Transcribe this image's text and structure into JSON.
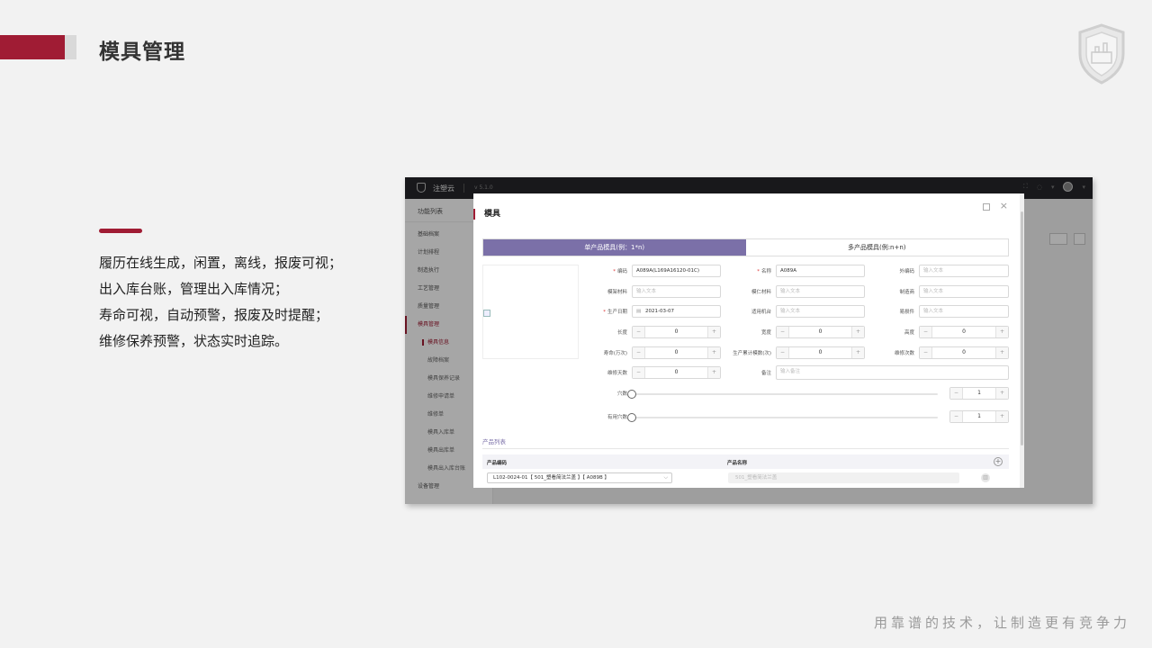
{
  "slide": {
    "title": "模具管理",
    "bullets": [
      "履历在线生成，闲置，离线，报废可视；",
      "出入库台账，管理出入库情况；",
      "寿命可视，自动预警，报废及时提醒；",
      "维修保养预警，状态实时追踪。"
    ],
    "slogan": "用靠谱的技术，让制造更有竞争力",
    "accent_color": "#a01c34"
  },
  "app": {
    "brand": "注塑云",
    "version": "v 5.1.0",
    "sidebar": {
      "header": "功能列表",
      "items": [
        {
          "label": "基础档案"
        },
        {
          "label": "计划排程"
        },
        {
          "label": "制造执行"
        },
        {
          "label": "工艺管理"
        },
        {
          "label": "质量管理"
        },
        {
          "label": "模具管理"
        }
      ],
      "sub_items": [
        {
          "label": "模具信息"
        },
        {
          "label": "故障档案"
        },
        {
          "label": "模具保养记录"
        },
        {
          "label": "维修申请单"
        },
        {
          "label": "维修单"
        },
        {
          "label": "模具入库单"
        },
        {
          "label": "模具出库单"
        },
        {
          "label": "模具出入库台账"
        }
      ],
      "footer_item": "设备管理"
    }
  },
  "modal": {
    "title": "模具",
    "tabs": [
      "单产品模具(例：1*n)",
      "多产品模具(例:n+n)"
    ],
    "fields": {
      "code_label": "编码",
      "code_value": "A089A(L169A16120-01C)",
      "name_label": "名称",
      "name_value": "A089A",
      "ext_code_label": "外编码",
      "ext_code_placeholder": "输入文本",
      "frame_material_label": "模架材料",
      "frame_material_placeholder": "输入文本",
      "core_material_label": "模仁材料",
      "core_material_placeholder": "输入文本",
      "maker_label": "制造商",
      "maker_placeholder": "输入文本",
      "date_label": "生产日期",
      "date_value": "2021-03-07",
      "machine_label": "适用机台",
      "machine_placeholder": "输入文本",
      "accessory_label": "易损件",
      "accessory_placeholder": "输入文本",
      "length_label": "长度",
      "length_value": "0",
      "width_label": "宽度",
      "width_value": "0",
      "height_label": "高度",
      "height_value": "0",
      "life_label": "寿命(万次)",
      "life_value": "0",
      "total_label": "生产累计模数(次)",
      "total_value": "0",
      "repair_count_label": "维修次数",
      "repair_count_value": "0",
      "repair_days_label": "维修天数",
      "repair_days_value": "0",
      "remark_label": "备注",
      "remark_placeholder": "输入备注",
      "cavity_label": "穴数",
      "cavity_value": "1",
      "valid_cavity_label": "有用穴数",
      "valid_cavity_value": "1"
    },
    "product_list": {
      "tab": "产品列表",
      "col_code": "产品编码",
      "col_name": "产品名称",
      "row_code": "L102-0024-01【 501_塑看简法兰盖 】【 A089B 】",
      "row_name": "501_塑看简法兰盖"
    }
  }
}
